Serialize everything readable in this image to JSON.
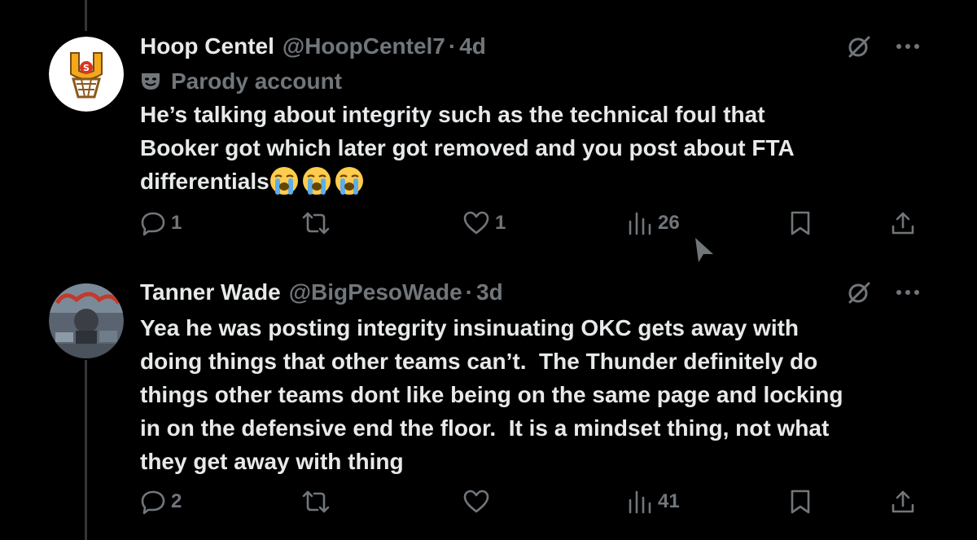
{
  "colors": {
    "background": "#000000",
    "text_primary": "#e7e9ea",
    "text_secondary": "#71767b",
    "thread_line": "#333639"
  },
  "tweets": [
    {
      "display_name": "Hoop Centel",
      "handle": "@HoopCentel7",
      "separator": "·",
      "time": "4d",
      "label_icon": "theater-masks-icon",
      "label": "Parody account",
      "text": "He’s talking about integrity such as the technical foul that\nBooker got which later got removed and you post about FTA\ndifferentials",
      "emojis": [
        "loudly-crying-face-emoji",
        "loudly-crying-face-emoji",
        "loudly-crying-face-emoji"
      ],
      "replies": "1",
      "reposts": "",
      "likes": "1",
      "views": "26"
    },
    {
      "display_name": "Tanner Wade",
      "handle": "@BigPesoWade",
      "separator": "·",
      "time": "3d",
      "text": "Yea he was posting integrity insinuating OKC gets away with\ndoing things that other teams can’t.  The Thunder definitely do\nthings other teams dont like being on the same page and locking\nin on the defensive end the floor.  It is a mindset thing, not what\nthey get away with thing",
      "replies": "2",
      "reposts": "",
      "likes": "",
      "views": "41"
    }
  ]
}
